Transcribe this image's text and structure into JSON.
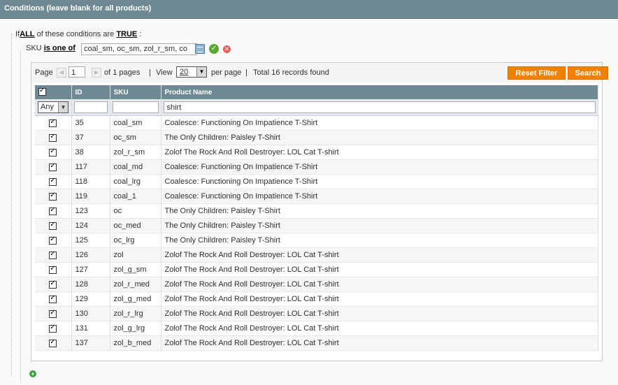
{
  "section_title": "Conditions (leave blank for all products)",
  "condition": {
    "prefix": "If",
    "aggregator": "ALL",
    "middle": "of these conditions are",
    "value": "TRUE",
    "suffix": ":"
  },
  "sku_rule": {
    "attribute": "SKU",
    "operator": "is one of",
    "value": "coal_sm, oc_sm, zol_r_sm, co"
  },
  "pager": {
    "page_label": "Page",
    "page_value": "1",
    "of_pages": "of 1 pages",
    "sep1": "|",
    "view_label": "View",
    "per_page": "20",
    "per_page_label": "per page",
    "sep2": "|",
    "total": "Total 16 records found"
  },
  "buttons": {
    "reset_filter": "Reset Filter",
    "search": "Search"
  },
  "columns": {
    "id": "ID",
    "sku": "SKU",
    "name": "Product Name"
  },
  "filters": {
    "select": "Any",
    "id": "",
    "sku": "",
    "name": "shirt"
  },
  "rows": [
    {
      "id": "35",
      "sku": "coal_sm",
      "name": "Coalesce: Functioning On Impatience T-Shirt"
    },
    {
      "id": "37",
      "sku": "oc_sm",
      "name": "The Only Children: Paisley T-Shirt"
    },
    {
      "id": "38",
      "sku": "zol_r_sm",
      "name": "Zolof The Rock And Roll Destroyer: LOL Cat T-shirt"
    },
    {
      "id": "117",
      "sku": "coal_md",
      "name": "Coalesce: Functioning On Impatience T-Shirt"
    },
    {
      "id": "118",
      "sku": "coal_lrg",
      "name": "Coalesce: Functioning On Impatience T-Shirt"
    },
    {
      "id": "119",
      "sku": "coal_1",
      "name": "Coalesce: Functioning On Impatience T-Shirt"
    },
    {
      "id": "123",
      "sku": "oc",
      "name": "The Only Children: Paisley T-Shirt"
    },
    {
      "id": "124",
      "sku": "oc_med",
      "name": "The Only Children: Paisley T-Shirt"
    },
    {
      "id": "125",
      "sku": "oc_lrg",
      "name": "The Only Children: Paisley T-Shirt"
    },
    {
      "id": "126",
      "sku": "zol",
      "name": "Zolof The Rock And Roll Destroyer: LOL Cat T-shirt"
    },
    {
      "id": "127",
      "sku": "zol_g_sm",
      "name": "Zolof The Rock And Roll Destroyer: LOL Cat T-shirt"
    },
    {
      "id": "128",
      "sku": "zol_r_med",
      "name": "Zolof The Rock And Roll Destroyer: LOL Cat T-shirt"
    },
    {
      "id": "129",
      "sku": "zol_g_med",
      "name": "Zolof The Rock And Roll Destroyer: LOL Cat T-shirt"
    },
    {
      "id": "130",
      "sku": "zol_r_lrg",
      "name": "Zolof The Rock And Roll Destroyer: LOL Cat T-shirt"
    },
    {
      "id": "131",
      "sku": "zol_g_lrg",
      "name": "Zolof The Rock And Roll Destroyer: LOL Cat T-shirt"
    },
    {
      "id": "137",
      "sku": "zol_b_med",
      "name": "Zolof The Rock And Roll Destroyer: LOL Cat T-shirt"
    }
  ],
  "icons": {
    "chooser": "list-chooser-icon",
    "apply": "apply-checkmark-icon",
    "remove": "remove-x-icon",
    "add": "add-condition-icon",
    "checkbox": "checkbox-checked"
  },
  "colors": {
    "header": "#6f8992",
    "button": "#f18200",
    "apply": "#5aa832",
    "remove": "#e65c5c",
    "add": "#3e9c3a"
  }
}
